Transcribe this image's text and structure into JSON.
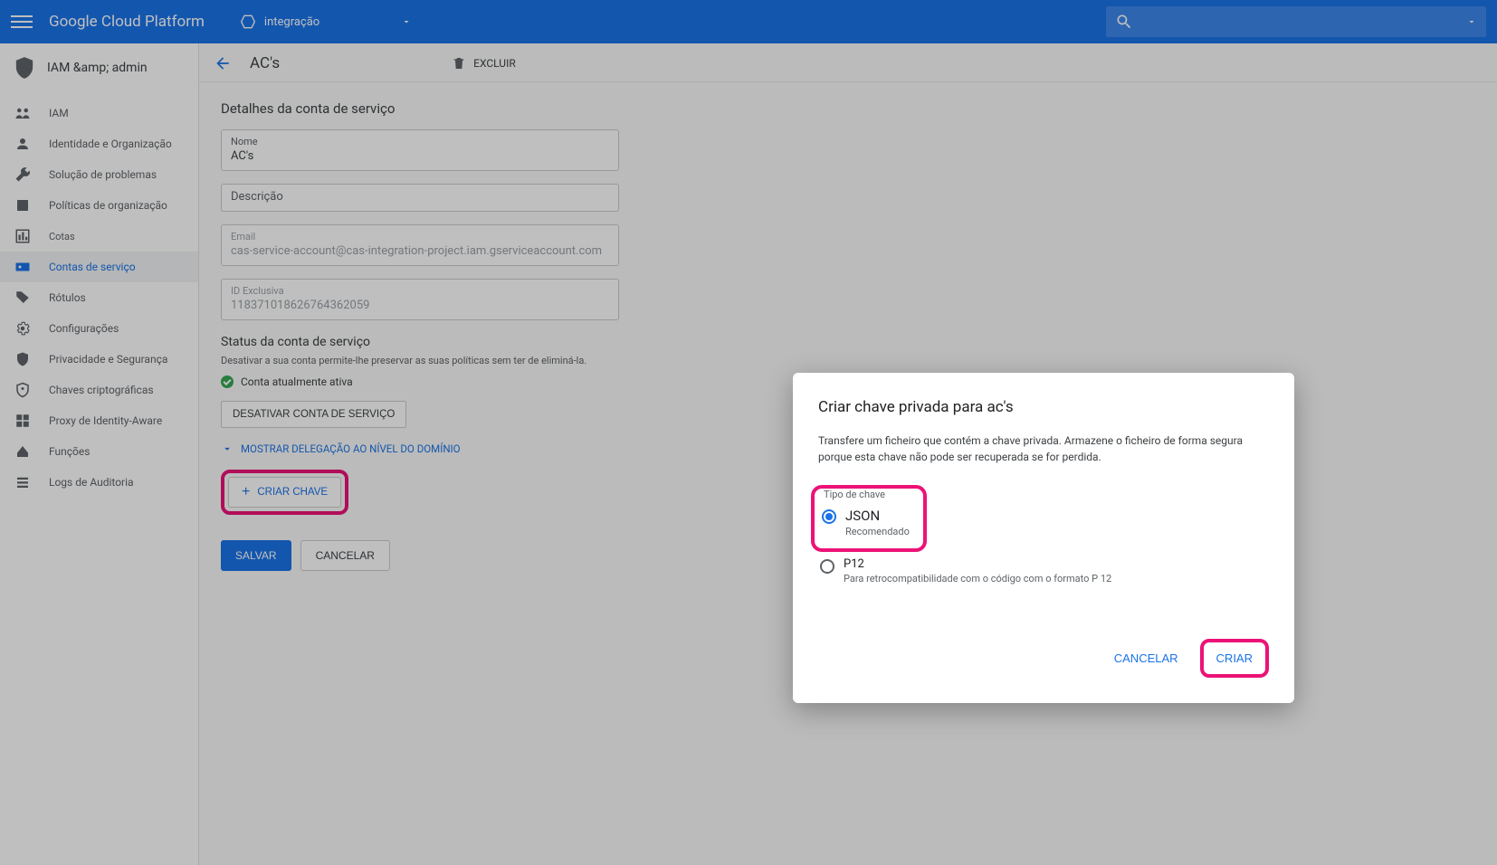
{
  "topbar": {
    "platform": "Google Cloud Platform",
    "project": "integração"
  },
  "sidebar": {
    "section": "IAM &amp; admin",
    "items": [
      {
        "label": "IAM"
      },
      {
        "label": "Identidade e Organização"
      },
      {
        "label": "Solução de problemas"
      },
      {
        "label": "Políticas de organização"
      },
      {
        "label": "Cotas"
      },
      {
        "label": "Contas de serviço"
      },
      {
        "label": "Rótulos"
      },
      {
        "label": "Configurações"
      },
      {
        "label": "Privacidade e Segurança"
      },
      {
        "label": "Chaves criptográficas"
      },
      {
        "label": "Proxy de Identity-Aware"
      },
      {
        "label": "Funções"
      },
      {
        "label": "Logs de Auditoria"
      }
    ]
  },
  "toolbar": {
    "title": "AC's",
    "delete_label": "EXCLUIR"
  },
  "details": {
    "heading": "Detalhes da conta de serviço",
    "name_label": "Nome",
    "name_value": "AC's",
    "desc_label": "Descrição",
    "email_label": "Email",
    "email_value": "cas-service-account@cas-integration-project.iam.gserviceaccount.com",
    "id_label": "ID Exclusiva",
    "id_value": "118371018626764362059"
  },
  "status": {
    "heading": "Status da conta de serviço",
    "hint": "Desativar a sua conta permite-lhe preservar as suas políticas sem ter de eliminá-la.",
    "active": "Conta atualmente ativa",
    "disable_btn": "DESATIVAR CONTA DE SERVIÇO",
    "expand": "MOSTRAR DELEGAÇÃO AO NÍVEL DO DOMÍNIO",
    "create_key": "CRIAR CHAVE",
    "save": "SALVAR",
    "cancel": "CANCELAR"
  },
  "dialog": {
    "title": "Criar chave privada para ac's",
    "desc": "Transfere um ficheiro que contém a chave privada. Armazene o ficheiro de forma segura porque esta chave não pode ser recuperada se for perdida.",
    "legend": "Tipo de chave",
    "opt1": "JSON",
    "opt1_sub": "Recomendado",
    "opt2": "P12",
    "opt2_sub": "Para retrocompatibilidade com o código com o formato P 12",
    "cancel": "CANCELAR",
    "create": "CRIAR"
  }
}
